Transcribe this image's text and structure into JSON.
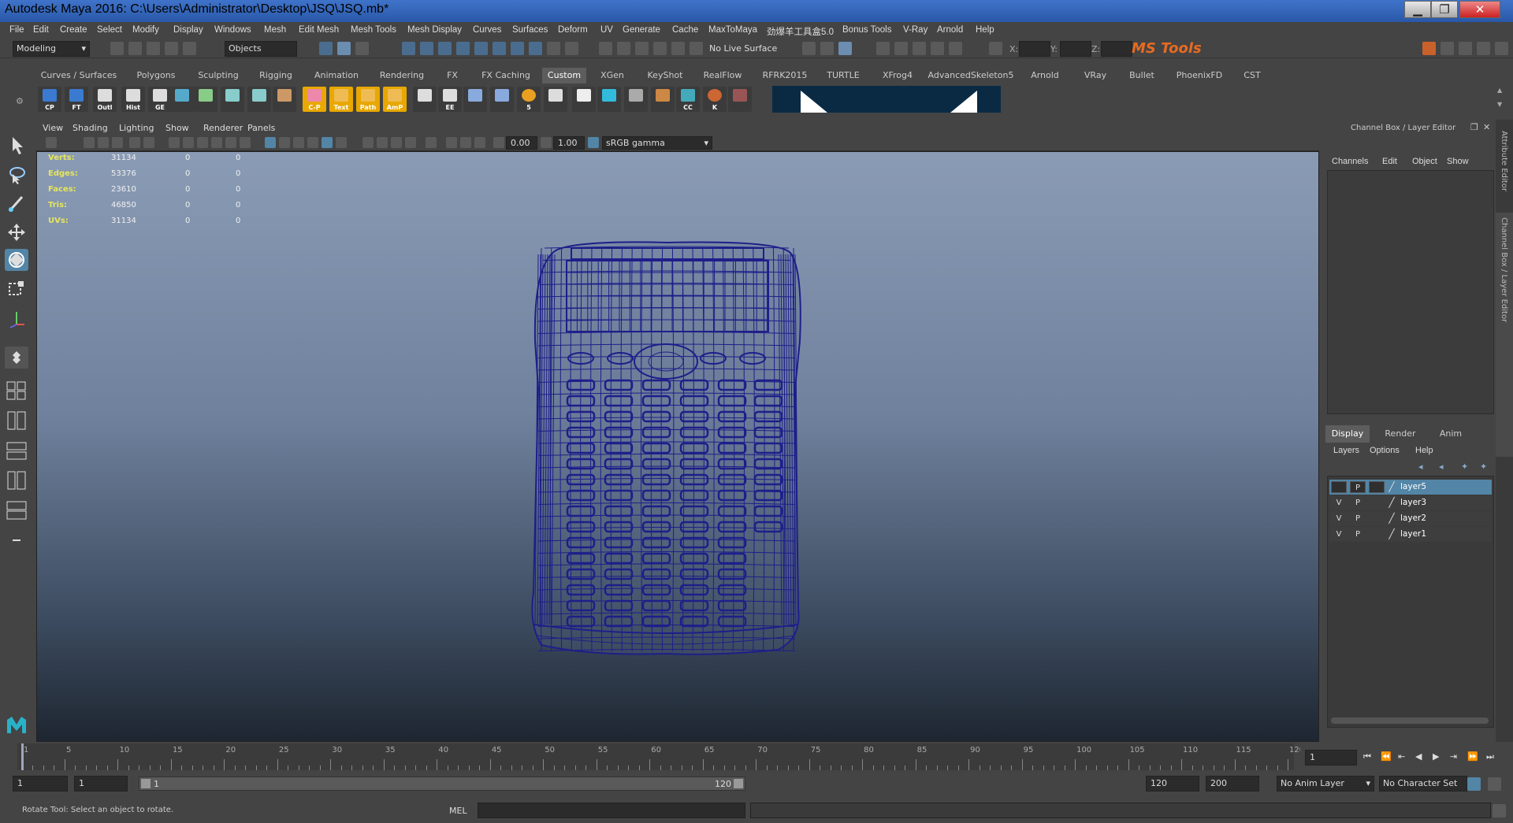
{
  "window": {
    "title": "Autodesk Maya 2016: C:\\Users\\Administrator\\Desktop\\JSQ\\JSQ.mb*",
    "minimize": "▁",
    "maximize": "❐",
    "close": "✕"
  },
  "menubar": [
    "File",
    "Edit",
    "Create",
    "Select",
    "Modify",
    "Display",
    "Windows",
    "Mesh",
    "Edit Mesh",
    "Mesh Tools",
    "Mesh Display",
    "Curves",
    "Surfaces",
    "Deform",
    "UV",
    "Generate",
    "Cache",
    "MaxToMaya",
    "劲爆羊工具盒5.0",
    "Bonus Tools",
    "V-Ray",
    "Arnold",
    "Help"
  ],
  "statusline": {
    "menuset": "Modeling",
    "select_mode": "Objects",
    "live_surface": "No Live Surface",
    "x_label": "X:",
    "y_label": "Y:",
    "z_label": "Z:",
    "ms_tools": "MS Tools"
  },
  "shelf_tabs": [
    "Curves / Surfaces",
    "Polygons",
    "Sculpting",
    "Rigging",
    "Animation",
    "Rendering",
    "FX",
    "FX Caching",
    "Custom",
    "XGen",
    "KeyShot",
    "RealFlow",
    "RFRK2015",
    "TURTLE",
    "XFrog4",
    "AdvancedSkeleton5",
    "Arnold",
    "VRay",
    "Bullet",
    "PhoenixFD",
    "CST"
  ],
  "active_shelf_tab": "Custom",
  "shelf_icons": [
    {
      "name": "cp-icon",
      "label": "CP",
      "color": "#3a7ad0"
    },
    {
      "name": "ft-icon",
      "label": "FT",
      "color": "#3a7ad0"
    },
    {
      "name": "outliner-icon",
      "label": "Outl",
      "color": "#ddd"
    },
    {
      "name": "hypergraph-icon",
      "label": "Hist",
      "color": "#ddd"
    },
    {
      "name": "ge-icon",
      "label": "GE",
      "color": "#ddd"
    },
    {
      "name": "sphere-icon",
      "label": "",
      "color": "#5ac"
    },
    {
      "name": "checker-icon",
      "label": "",
      "color": "#8c8"
    },
    {
      "name": "node-editor-icon",
      "label": "",
      "color": "#8cc"
    },
    {
      "name": "graph-icon",
      "label": "",
      "color": "#8cc"
    },
    {
      "name": "paint-icon",
      "label": "",
      "color": "#c96"
    },
    {
      "name": "cp-text-icon",
      "label": "C-P",
      "color": "#e8a"
    },
    {
      "name": "text-icon",
      "label": "Text",
      "color": "#eb5"
    },
    {
      "name": "path-icon",
      "label": "Path",
      "color": "#eb5"
    },
    {
      "name": "amp-icon",
      "label": "AmP",
      "color": "#eb5"
    },
    {
      "name": "script-icon",
      "label": "",
      "color": "#ddd"
    },
    {
      "name": "ee-icon",
      "label": "EE",
      "color": "#ddd"
    },
    {
      "name": "gear-move-icon",
      "label": "",
      "color": "#8ad"
    },
    {
      "name": "brush-icon",
      "label": "",
      "color": "#8ad"
    },
    {
      "name": "five-icon",
      "label": "5",
      "color": "#e9a020"
    },
    {
      "name": "rig-icon",
      "label": "",
      "color": "#ddd"
    },
    {
      "name": "skull-icon",
      "label": "",
      "color": "#eee"
    },
    {
      "name": "joint-icon",
      "label": "",
      "color": "#3bd"
    },
    {
      "name": "cloth-icon",
      "label": "",
      "color": "#aaa"
    },
    {
      "name": "phoenix-icon",
      "label": "",
      "color": "#c84"
    },
    {
      "name": "cc-icon",
      "label": "CC",
      "color": "#4ab"
    },
    {
      "name": "k-icon",
      "label": "K",
      "color": "#c63"
    },
    {
      "name": "image-icon",
      "label": "",
      "color": "#955"
    }
  ],
  "viewport": {
    "menus": [
      "View",
      "Shading",
      "Lighting",
      "Show",
      "Renderer",
      "Panels"
    ],
    "exposure": "0.00",
    "gamma": "1.00",
    "color_space": "sRGB gamma",
    "hud": [
      {
        "label": "Verts:",
        "values": [
          "31134",
          "0",
          "0"
        ]
      },
      {
        "label": "Edges:",
        "values": [
          "53376",
          "0",
          "0"
        ]
      },
      {
        "label": "Faces:",
        "values": [
          "23610",
          "0",
          "0"
        ]
      },
      {
        "label": "Tris:",
        "values": [
          "46850",
          "0",
          "0"
        ]
      },
      {
        "label": "UVs:",
        "values": [
          "31134",
          "0",
          "0"
        ]
      }
    ],
    "wire_color": "#1e1e8a"
  },
  "channel_box": {
    "title": "Channel Box / Layer Editor",
    "menus": [
      "Channels",
      "Edit",
      "Object",
      "Show"
    ]
  },
  "layer_editor": {
    "tabs": [
      "Display",
      "Render",
      "Anim"
    ],
    "active_tab": "Display",
    "menus": [
      "Layers",
      "Options",
      "Help"
    ],
    "layers": [
      {
        "name": "layer5",
        "v": "",
        "p": "P",
        "selected": true
      },
      {
        "name": "layer3",
        "v": "V",
        "p": "P",
        "selected": false
      },
      {
        "name": "layer2",
        "v": "V",
        "p": "P",
        "selected": false
      },
      {
        "name": "layer1",
        "v": "V",
        "p": "P",
        "selected": false
      }
    ]
  },
  "side_strip": {
    "attribute_editor": "Attribute Editor",
    "channel_box": "Channel Box / Layer Editor"
  },
  "timeline": {
    "ticks": [
      "1",
      "5",
      "10",
      "15",
      "20",
      "25",
      "30",
      "35",
      "40",
      "45",
      "50",
      "55",
      "60",
      "65",
      "70",
      "75",
      "80",
      "85",
      "90",
      "95",
      "100",
      "105",
      "110",
      "115",
      "120"
    ],
    "current_frame": "1"
  },
  "range": {
    "start": "1",
    "playback_start": "1",
    "slider_start": "1",
    "slider_end": "120",
    "playback_end": "120",
    "end": "200",
    "anim_layer": "No Anim Layer",
    "character_set": "No Character Set"
  },
  "command": {
    "help_line": "Rotate Tool: Select an object to rotate.",
    "lang": "MEL"
  }
}
